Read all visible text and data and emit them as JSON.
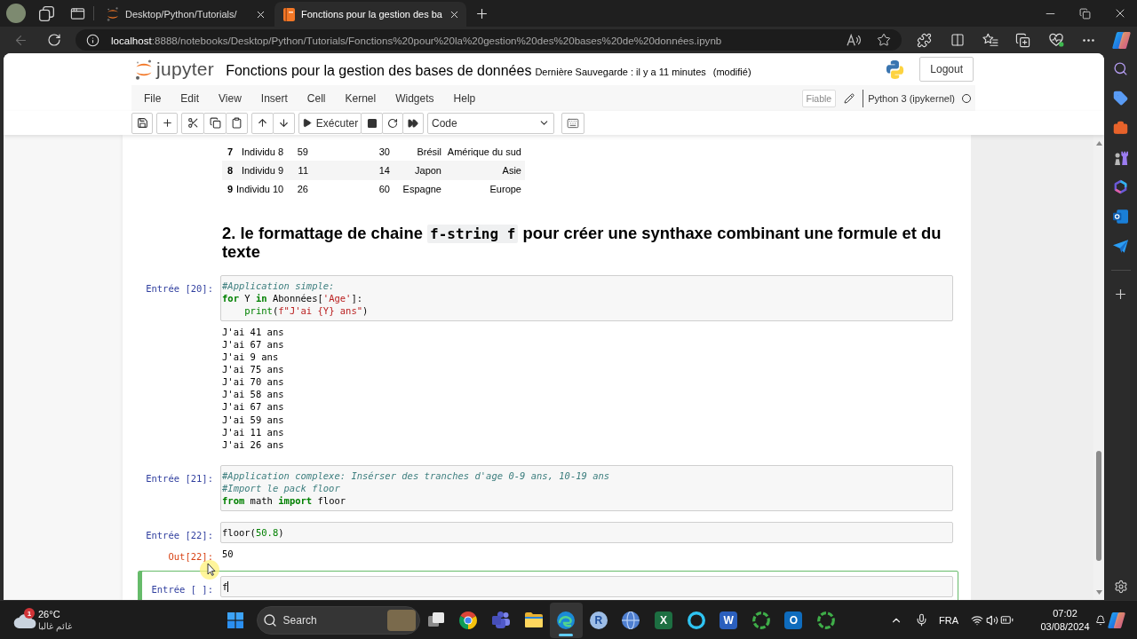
{
  "browser": {
    "tabs": [
      {
        "kind": "orbit",
        "title": "Desktop/Python/Tutorials/",
        "selected": false
      },
      {
        "kind": "notebook",
        "title": "Fonctions pour la gestion des ba",
        "selected": true
      }
    ],
    "back": {
      "disabled": true
    },
    "url": {
      "host": "localhost",
      "path": ":8888/notebooks/Desktop/Python/Tutorials/Fonctions%20pour%20la%20gestion%20des%20bases%20de%20données.ipynb"
    }
  },
  "jupyter": {
    "logo_text": "jupyter",
    "title": "Fonctions pour la gestion des bases de données",
    "save_status": "Dernière Sauvegarde : il y a 11 minutes",
    "modified": "(modifié)",
    "logout": "Logout",
    "menu": [
      "File",
      "Edit",
      "View",
      "Insert",
      "Cell",
      "Kernel",
      "Widgets",
      "Help"
    ],
    "trusted": "Fiable",
    "edit_mode": true,
    "kernel": "Python 3 (ipykernel)",
    "kernel_busy": false,
    "run_label": "Exécuter",
    "cell_type": "Code"
  },
  "notebook": {
    "table": {
      "rows": [
        {
          "index": "7",
          "cells": [
            "Individu 8",
            "59",
            "30",
            "Brésil",
            "Amérique du sud"
          ]
        },
        {
          "index": "8",
          "cells": [
            "Individu 9",
            "11",
            "14",
            "Japon",
            "Asie"
          ]
        },
        {
          "index": "9",
          "cells": [
            "Individu 10",
            "26",
            "60",
            "Espagne",
            "Europe"
          ]
        }
      ]
    },
    "heading": [
      {
        "kind": "text",
        "text": "2. le formattage de chaine"
      },
      {
        "kind": "code",
        "text": "f-string f"
      },
      {
        "kind": "text",
        "text": "pour créer une synthaxe combinant une formule et du texte"
      }
    ],
    "cells": [
      {
        "prompt": "Entrée [20]:",
        "selected": false,
        "lines": [
          [
            {
              "kind": "comment",
              "text": "#Application simple:"
            }
          ],
          [
            {
              "kind": "keyword",
              "text": "for"
            },
            {
              "kind": "plain",
              "text": " Y "
            },
            {
              "kind": "keyword",
              "text": "in"
            },
            {
              "kind": "plain",
              "text": " Abonnées["
            },
            {
              "kind": "string",
              "text": "'Age'"
            },
            {
              "kind": "plain",
              "text": "]:"
            }
          ],
          [
            {
              "kind": "builtin",
              "text": "    print"
            },
            {
              "kind": "plain",
              "text": "("
            },
            {
              "kind": "string",
              "text": "f\"J'ai {Y} ans\""
            },
            {
              "kind": "plain",
              "text": ")"
            }
          ]
        ],
        "output": {
          "kind": "stream",
          "lines": [
            "J'ai 41 ans",
            "J'ai 67 ans",
            "J'ai 9 ans",
            "J'ai 75 ans",
            "J'ai 70 ans",
            "J'ai 58 ans",
            "J'ai 67 ans",
            "J'ai 59 ans",
            "J'ai 11 ans",
            "J'ai 26 ans"
          ]
        }
      },
      {
        "prompt": "Entrée [21]:",
        "selected": false,
        "lines": [
          [
            {
              "kind": "comment",
              "text": "#Application complexe: Insérser des tranches d'age 0-9 ans, 10-19 ans"
            }
          ],
          [
            {
              "kind": "comment",
              "text": "#Import le pack floor"
            }
          ],
          [
            {
              "kind": "keyword",
              "text": "from"
            },
            {
              "kind": "plain",
              "text": " math "
            },
            {
              "kind": "keyword",
              "text": "import"
            },
            {
              "kind": "plain",
              "text": " floor"
            }
          ]
        ]
      },
      {
        "prompt": "Entrée [22]:",
        "selected": false,
        "lines": [
          [
            {
              "kind": "plain",
              "text": "floor("
            },
            {
              "kind": "number",
              "text": "50.8"
            },
            {
              "kind": "plain",
              "text": ")"
            }
          ]
        ],
        "output": {
          "kind": "result",
          "prompt": "Out[22]:",
          "lines": [
            "50"
          ]
        }
      },
      {
        "prompt": "Entrée [ ]:",
        "selected": true,
        "lines": [
          [
            {
              "kind": "plain",
              "text": "f"
            }
          ]
        ]
      }
    ]
  },
  "taskbar": {
    "weather": {
      "alerts": "1",
      "temperature": "26°C",
      "condition": "غائم غالبا"
    },
    "search": "Search",
    "apps": [
      {
        "kind": "taskview",
        "selected": false
      },
      {
        "kind": "chrome",
        "selected": false
      },
      {
        "kind": "teams",
        "selected": false
      },
      {
        "kind": "explorer",
        "selected": false
      },
      {
        "kind": "edge",
        "selected": true
      },
      {
        "kind": "r",
        "letter": "R",
        "selected": false
      },
      {
        "kind": "sphere",
        "selected": false
      },
      {
        "kind": "excel",
        "letter": "X",
        "selected": false
      },
      {
        "kind": "ring",
        "selected": false
      },
      {
        "kind": "word",
        "letter": "W",
        "selected": false
      },
      {
        "kind": "spinner",
        "selected": false
      },
      {
        "kind": "outlook",
        "letter": "O",
        "selected": false
      },
      {
        "kind": "spinner",
        "selected": false
      }
    ],
    "language": "FRA",
    "time": "07:02",
    "date": "03/08/2024"
  }
}
